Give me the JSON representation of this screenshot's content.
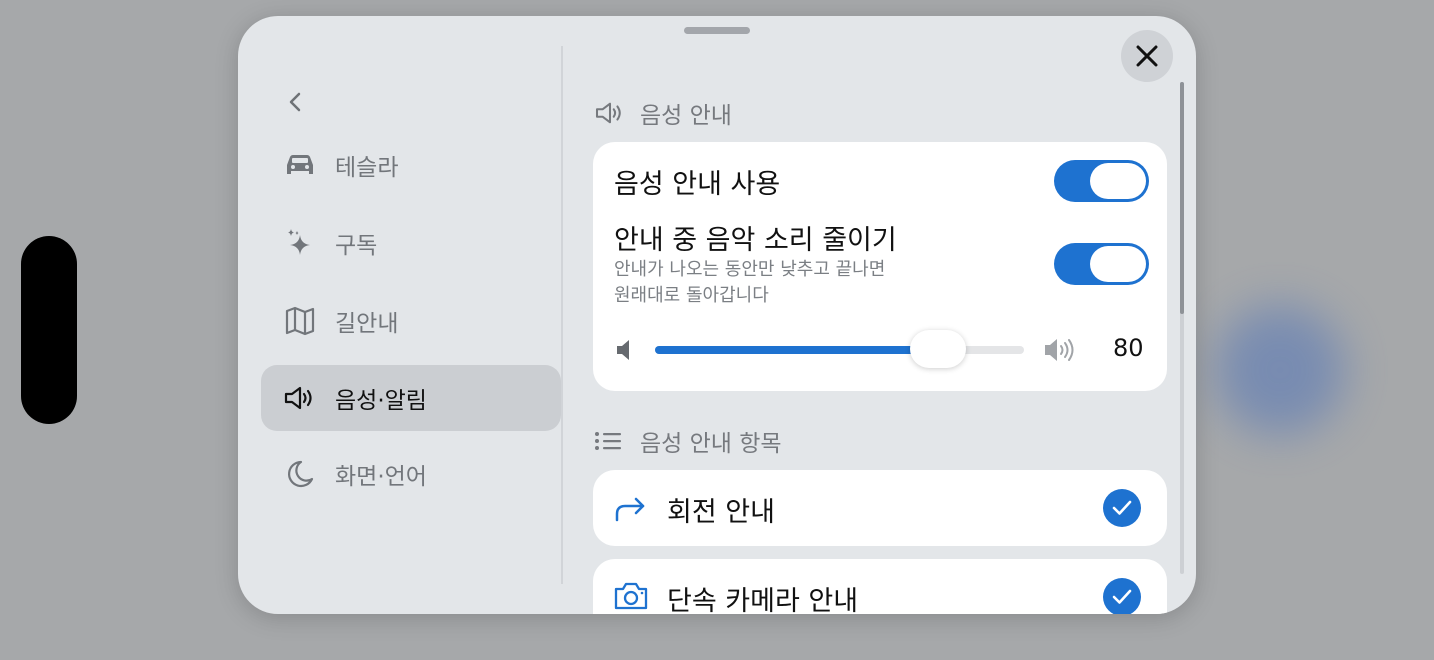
{
  "sidebar": {
    "items": [
      {
        "label": "테슬라",
        "icon": "car-icon"
      },
      {
        "label": "구독",
        "icon": "sparkle-icon"
      },
      {
        "label": "길안내",
        "icon": "map-icon"
      },
      {
        "label": "음성·알림",
        "icon": "speaker-icon"
      },
      {
        "label": "화면·언어",
        "icon": "moon-icon"
      }
    ],
    "active_index": 3
  },
  "voice_guide": {
    "section_title": "음성 안내",
    "use_label": "음성 안내 사용",
    "use_enabled": true,
    "duck_label": "안내 중 음악 소리 줄이기",
    "duck_desc_line1": "안내가 나오는 동안만 낮추고 끝나면",
    "duck_desc_line2": "원래대로 돌아갑니다",
    "duck_enabled": true,
    "volume": 80,
    "volume_label": "80"
  },
  "guide_items": {
    "section_title": "음성 안내 항목",
    "items": [
      {
        "label": "회전 안내",
        "icon": "turn-right-arrow-icon",
        "checked": true
      },
      {
        "label": "단속 카메라 안내",
        "icon": "camera-icon",
        "checked": true
      }
    ]
  },
  "colors": {
    "accent": "#1e72d0",
    "sheet_bg": "#e3e6e9",
    "active_nav_bg": "#cbced2"
  }
}
